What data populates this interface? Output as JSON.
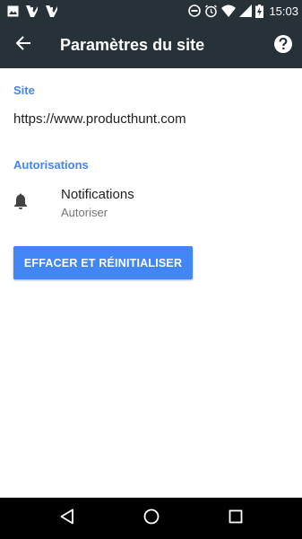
{
  "status_bar": {
    "time": "15:03",
    "left_icons": [
      "image-icon",
      "download-check-icon",
      "download-check-icon"
    ],
    "right_icons": [
      "dnd-icon",
      "alarm-icon",
      "wifi-icon",
      "signal-icon",
      "battery-charging-icon"
    ]
  },
  "app_bar": {
    "back_icon": "arrow-back-icon",
    "title": "Paramètres du site",
    "help_icon": "help-icon"
  },
  "site_section": {
    "header": "Site",
    "url": "https://www.producthunt.com"
  },
  "permissions_section": {
    "header": "Autorisations",
    "items": [
      {
        "icon": "bell-icon",
        "title": "Notifications",
        "value": "Autoriser"
      }
    ]
  },
  "reset_button": {
    "label": "EFFACER ET RÉINITIALISER"
  },
  "nav_bar": {
    "icons": [
      "back-triangle-icon",
      "home-circle-icon",
      "recents-square-icon"
    ]
  },
  "colors": {
    "bar_background": "#263238",
    "accent": "#4285f4",
    "nav_background": "#000000"
  }
}
